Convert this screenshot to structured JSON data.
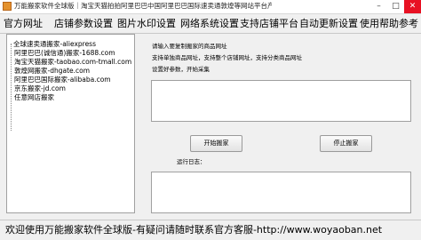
{
  "window": {
    "title": "万能搬家软件全球版｜淘宝天猫拍拍阿里巴巴中国阿里巴巴国际速卖通敦煌等网站平台产品复制搬家",
    "min_glyph": "–",
    "max_glyph": "□",
    "close_glyph": "✕"
  },
  "menu": {
    "items": [
      "官方网址",
      "店铺参数设置",
      "图片水印设置",
      "网络系统设置",
      "支持店铺平台",
      "自动更新设置",
      "使用帮助参考"
    ]
  },
  "sites": {
    "items": [
      "全球速卖通搬家-aliexpress",
      "阿里巴巴(诚信通)搬家-1688.com",
      "淘宝天猫搬家-taobao.com-tmall.com",
      "敦煌网搬家-dhgate.com",
      "阿里巴巴国际搬家-alibaba.com",
      "京东搬家-jd.com",
      "任意网店搬家"
    ]
  },
  "main": {
    "instructions": [
      "请输入要复制搬家的商品网址",
      "支持单独商品网址，支持整个店铺网址，支持分类商品网址",
      "设置好参数，开始采集"
    ],
    "url_input_value": "",
    "start_button": "开始搬家",
    "stop_button": "停止搬家",
    "log_label": "运行日志：",
    "log_value": ""
  },
  "status": {
    "text": "欢迎使用万能搬家软件全球版-有疑问请随时联系官方客服-http://www.woyaoban.net"
  }
}
